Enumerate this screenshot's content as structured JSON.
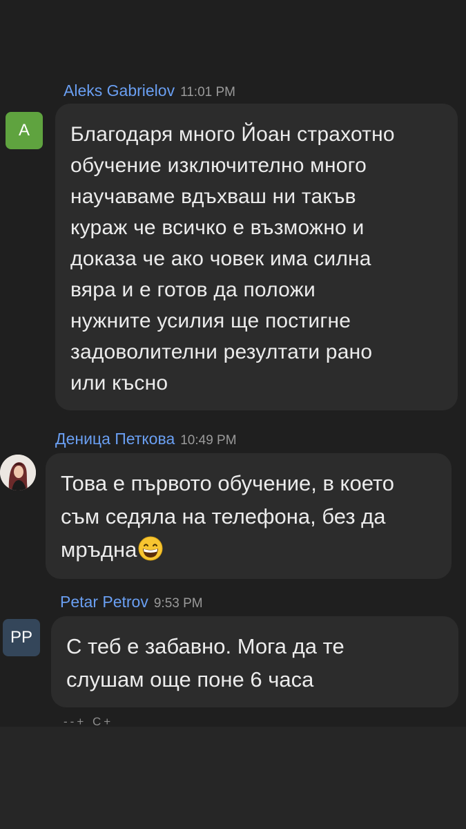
{
  "messages": [
    {
      "sender": "Aleks Gabrielov",
      "time": "11:01 PM",
      "avatar": {
        "initials": "A",
        "color": "#5fa33f"
      },
      "text": "Благодаря много Йоан страхотно\nобучение изключително много\nнаучаваме вдъхваш ни такъв\nкураж че всичко е възможно и\nдоказа че ако човек има силна\nвяра и е готов да положи\nнужните усилия ще постигне\nзадоволителни резултати рано\nили късно"
    },
    {
      "sender": "Деница Петкова",
      "time": "10:49 PM",
      "avatar": {
        "type": "photo"
      },
      "text": "Това е първото обучение, в което\nсъм седяла на телефона, без да\nмръдна",
      "emoji": "grinning-face-emoji"
    },
    {
      "sender": "Petar Petrov",
      "time": "9:53 PM",
      "avatar": {
        "initials": "PP",
        "color": "#34465a"
      },
      "text": "С теб е забавно. Мога да те\nслушам още поне 6 часа"
    }
  ],
  "footer_hint": "--+ C+"
}
